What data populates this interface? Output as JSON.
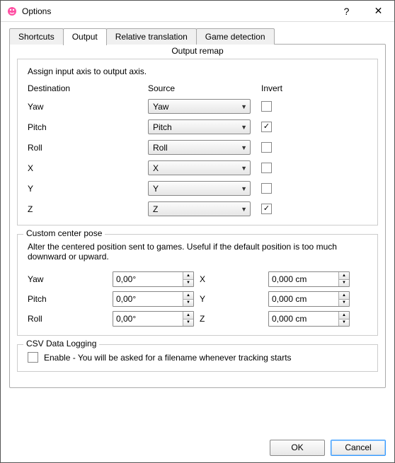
{
  "window": {
    "title": "Options",
    "help_icon": "?",
    "close_icon": "✕"
  },
  "tabs": {
    "shortcuts": "Shortcuts",
    "output": "Output",
    "relative": "Relative translation",
    "game": "Game detection",
    "active": "output"
  },
  "panel_title": "Output remap",
  "remap": {
    "intro": "Assign input axis to output axis.",
    "headers": {
      "dest": "Destination",
      "src": "Source",
      "inv": "Invert"
    },
    "rows": [
      {
        "dest": "Yaw",
        "src": "Yaw",
        "invert": false
      },
      {
        "dest": "Pitch",
        "src": "Pitch",
        "invert": true
      },
      {
        "dest": "Roll",
        "src": "Roll",
        "invert": false
      },
      {
        "dest": "X",
        "src": "X",
        "invert": false
      },
      {
        "dest": "Y",
        "src": "Y",
        "invert": false
      },
      {
        "dest": "Z",
        "src": "Z",
        "invert": true
      }
    ]
  },
  "center": {
    "legend": "Custom center pose",
    "desc": "Alter the centered position sent to games. Useful if the default position is too much downward or upward.",
    "rows": [
      {
        "a_label": "Yaw",
        "a_val": "0,00°",
        "b_label": "X",
        "b_val": "0,000 cm"
      },
      {
        "a_label": "Pitch",
        "a_val": "0,00°",
        "b_label": "Y",
        "b_val": "0,000 cm"
      },
      {
        "a_label": "Roll",
        "a_val": "0,00°",
        "b_label": "Z",
        "b_val": "0,000 cm"
      }
    ]
  },
  "csv": {
    "legend": "CSV Data Logging",
    "enable_checked": false,
    "enable_label": "Enable - You will be asked for a filename whenever tracking starts"
  },
  "footer": {
    "ok": "OK",
    "cancel": "Cancel"
  }
}
